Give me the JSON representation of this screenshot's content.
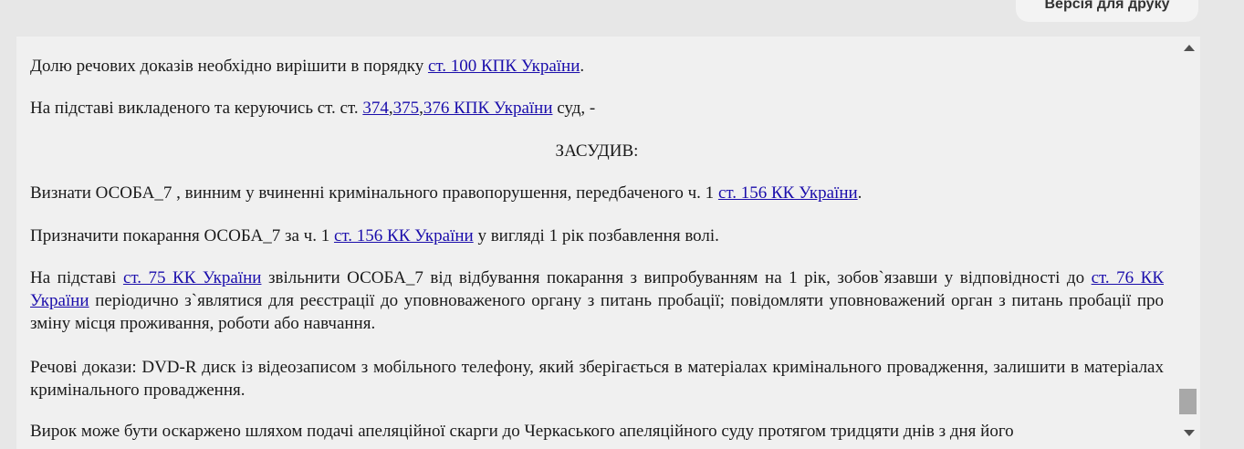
{
  "toolbar": {
    "print_label": "Версія для друку"
  },
  "document": {
    "p1": {
      "t1": "Долю речових доказів необхідно вирішити в порядку ",
      "link1": "ст. 100 КПК України",
      "t2": "."
    },
    "p2": {
      "t1": "На підставі викладеного та керуючись ст. ст. ",
      "link1": "374",
      "sep1": ",",
      "link2": "375",
      "sep2": ",",
      "link3": "376 КПК України",
      "t2": " суд, -"
    },
    "heading": "ЗАСУДИВ:",
    "p3": {
      "t1": "Визнати ОСОБА_7 , винним у вчиненні кримінального правопорушення, передбаченого ч. 1 ",
      "link1": "ст. 156 КК України",
      "t2": "."
    },
    "p4": {
      "t1": "Призначити покарання ОСОБА_7 за ч. 1 ",
      "link1": "ст. 156 КК України",
      "t2": " у вигляді 1 рік позбавлення волі."
    },
    "p5": {
      "t1": "На підставі ",
      "link1": "ст. 75 КК України",
      "t2": " звільнити ОСОБА_7 від відбування покарання з випробуванням на 1 рік, зобов`язавши у відповідності до ",
      "link2": "ст. 76 КК України",
      "t3": " періодично з`являтися для реєстрації до уповноваженого органу з питань пробації; повідомляти уповноважений орган з питань пробації про зміну місця проживання, роботи або навчання."
    },
    "p6": {
      "t1": "Речові докази: DVD-R диск із відеозаписом з мобільного телефону, який зберігається в матеріалах кримінального провадження, залишити в матеріалах кримінального провадження."
    },
    "p7": {
      "t1": "Вирок може бути оскаржено шляхом подачі апеляційної скарги до Черкаського апеляційного суду протягом тридцяти днів з дня його"
    }
  }
}
